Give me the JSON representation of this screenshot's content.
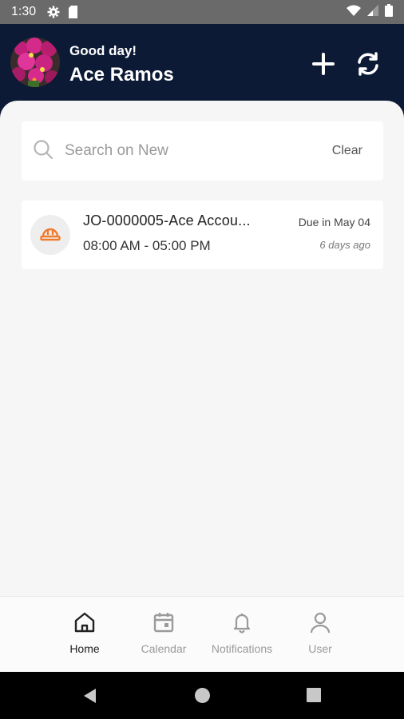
{
  "status_bar": {
    "time": "1:30",
    "icons": [
      "gear-icon",
      "sim-card-icon",
      "wifi-icon",
      "signal-icon",
      "battery-icon"
    ]
  },
  "header": {
    "greeting": "Good day!",
    "user_name": "Ace Ramos",
    "actions": [
      "plus-icon",
      "refresh-icon"
    ],
    "background_color": "#0c1a35"
  },
  "search": {
    "placeholder": "Search on New",
    "clear_label": "Clear"
  },
  "jobs": [
    {
      "title": "JO-0000005-Ace Accou...",
      "time_range": "08:00 AM - 05:00 PM",
      "due": "Due in May 04",
      "age": "6 days ago",
      "icon": "hard-hat-icon",
      "icon_color": "#f07a2c"
    }
  ],
  "bottom_nav": {
    "items": [
      {
        "label": "Home",
        "icon": "home-icon",
        "active": true
      },
      {
        "label": "Calendar",
        "icon": "calendar-icon",
        "active": false
      },
      {
        "label": "Notifications",
        "icon": "bell-icon",
        "active": false
      },
      {
        "label": "User",
        "icon": "user-icon",
        "active": false
      }
    ]
  },
  "system_nav": [
    "back-icon",
    "home-circle-icon",
    "recents-icon"
  ]
}
